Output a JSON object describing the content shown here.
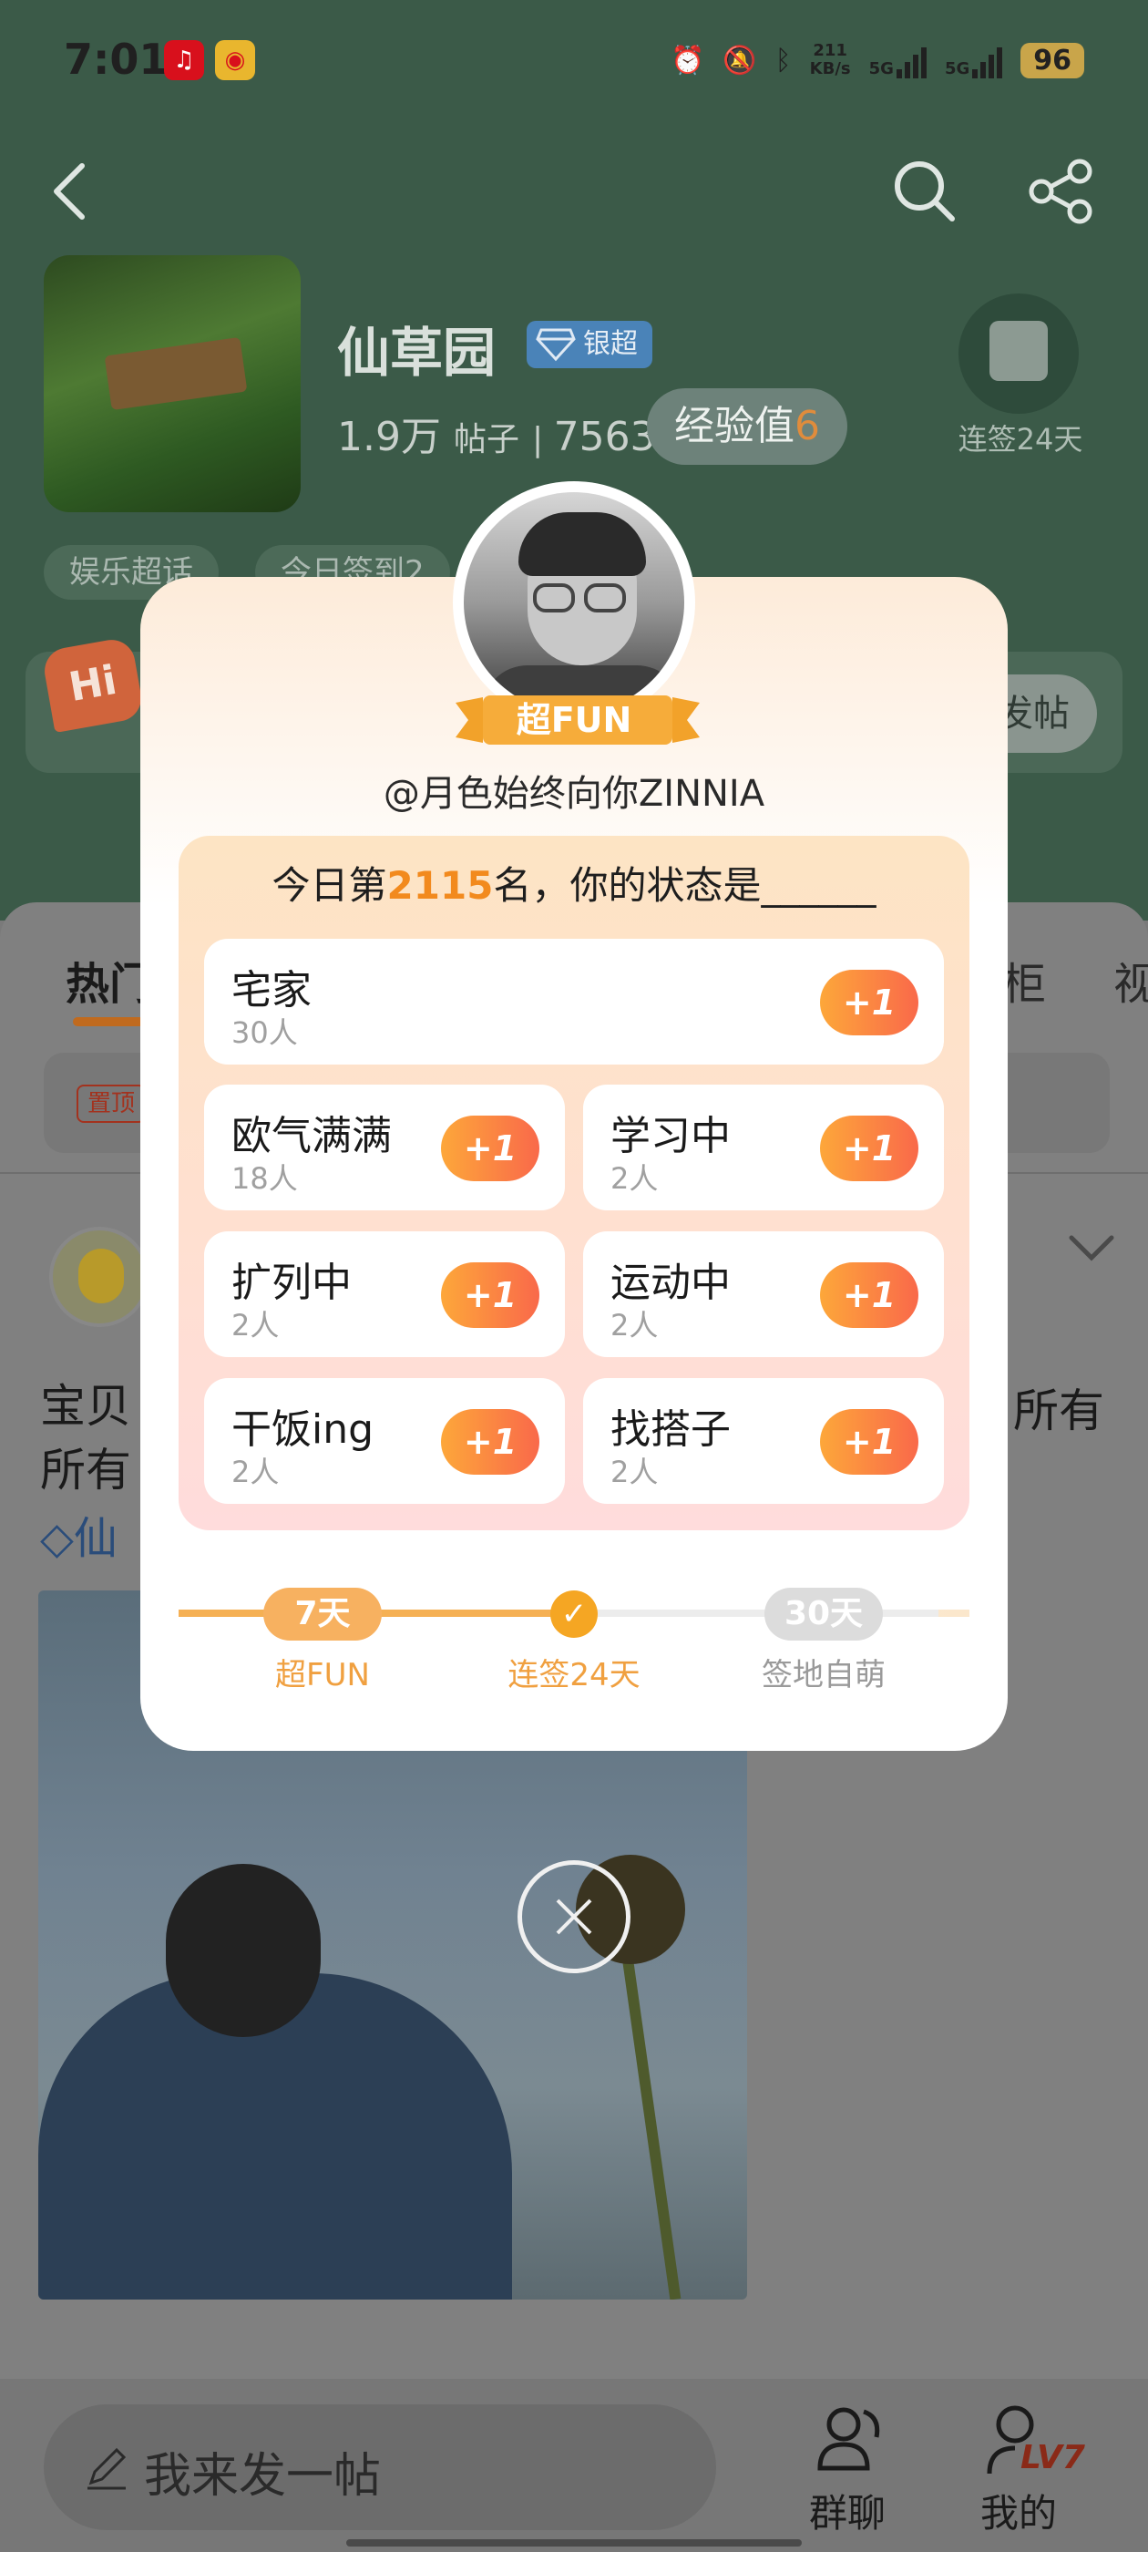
{
  "status_bar": {
    "time": "7:01",
    "net_speed_value": "211",
    "net_speed_unit": "KB/s",
    "signal_1": "5G",
    "signal_2": "5G",
    "battery": "96"
  },
  "forum": {
    "title": "仙草园",
    "badge": "银超",
    "posts_count": "1.9万",
    "posts_label": "帖子",
    "members_partial": "7563",
    "exp_label": "经验值",
    "exp_value": "6",
    "checkin_label": "连签24天",
    "tag_1": "娱乐超话",
    "tag_2": "今日签到2",
    "hi": "Hi",
    "post_button": "发帖"
  },
  "feed": {
    "tab_hot": "热门",
    "tab_ghost_1": "柜",
    "tab_ghost_2": "视",
    "pinned_tag": "置顶",
    "post_line_1": "宝贝",
    "post_line_1_right": "所有",
    "post_line_2": "所有",
    "post_topic": "仙"
  },
  "bottom": {
    "compose_placeholder": "我来发一帖",
    "group_chat": "群聊",
    "mine": "我的",
    "level": "LV7"
  },
  "modal": {
    "rank_ribbon": "超FUN",
    "username": "@月色始终向你ZINNIA",
    "question_prefix": "今日第",
    "rank_number": "2115",
    "question_suffix": "名，你的状态是______",
    "options": [
      {
        "name": "宅家",
        "count": "30人",
        "button": "+1"
      },
      {
        "name": "欧气满满",
        "count": "18人",
        "button": "+1"
      },
      {
        "name": "学习中",
        "count": "2人",
        "button": "+1"
      },
      {
        "name": "扩列中",
        "count": "2人",
        "button": "+1"
      },
      {
        "name": "运动中",
        "count": "2人",
        "button": "+1"
      },
      {
        "name": "干饭ing",
        "count": "2人",
        "button": "+1"
      },
      {
        "name": "找搭子",
        "count": "2人",
        "button": "+1"
      }
    ],
    "milestones": [
      {
        "pill": "7天",
        "label": "超FUN"
      },
      {
        "pill": "",
        "label": "连签24天"
      },
      {
        "pill": "30天",
        "label": "签地自萌"
      }
    ]
  },
  "colors": {
    "accent_orange": "#f28a1e",
    "button_gradient_start": "#fda73a",
    "button_gradient_end": "#f9694a",
    "badge_blue": "#4a83b8"
  }
}
